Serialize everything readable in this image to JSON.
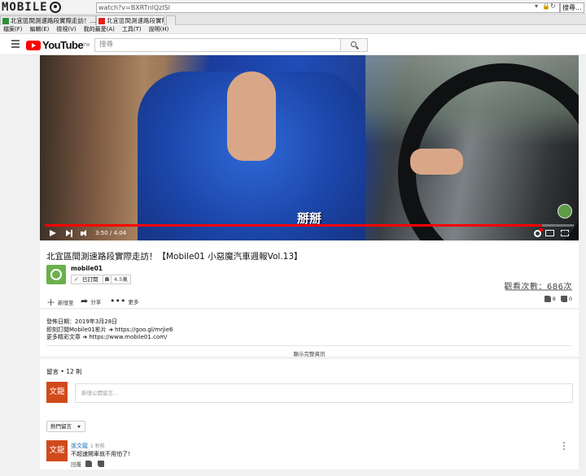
{
  "browser": {
    "overlay_logo": "MOBILE",
    "url": "watch?v=BXRTnlQzlSI",
    "search_placeholder": "搜尋...",
    "tabs": [
      {
        "label": "北宜區間測速路段實際走訪！..."
      },
      {
        "label": "北宜區間測速路段實際走訪..."
      }
    ],
    "menu": [
      "檔案(F)",
      "編輯(E)",
      "檢視(V)",
      "我的最愛(A)",
      "工具(T)",
      "說明(H)"
    ]
  },
  "youtube": {
    "logo_text": "YouTube",
    "logo_tm": "TW",
    "search_placeholder": "搜尋"
  },
  "player": {
    "subtitle": "掰掰",
    "time": "3:50 / 4:04",
    "progress_fraction": 0.94,
    "colors": {
      "progress": "#ff0000",
      "brand_red": "#ff0000"
    }
  },
  "video": {
    "title": "北宜區間測速路段實際走訪！【Mobile01 小惡魔汽車週報Vol.13】",
    "channel": "mobile01",
    "subscribe_label": "已訂閱",
    "subscriber_count": "4.5萬",
    "views": "觀看次數：686次",
    "actions": {
      "add": "新增至",
      "share": "分享",
      "more": "更多"
    },
    "likes": "8",
    "dislikes": "0"
  },
  "description": {
    "date": "發佈日期：2019年3月28日",
    "line1": "即刻訂閱Mobile01影片 ➜ https://goo.gl/mrjie6",
    "line2": "更多精彩文章 ➜ https://www.mobile01.com/",
    "show_more": "顯示完整資訊"
  },
  "comments": {
    "count_label": "留言 • 12 則",
    "avatar_text": "文龍",
    "input_placeholder": "新增公開留言...",
    "sort_label": "熱門留言",
    "items": [
      {
        "avatar_text": "文龍",
        "author": "張文龍",
        "time": "1 秒前",
        "text": "不超速開車就不用怕了!",
        "reply": "回覆"
      }
    ]
  }
}
